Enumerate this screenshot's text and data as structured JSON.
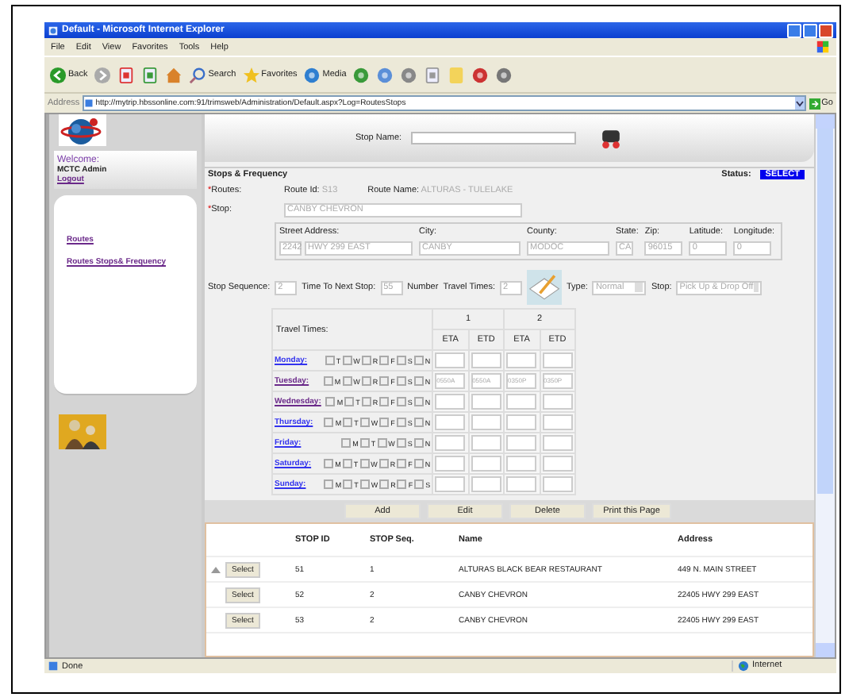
{
  "window": {
    "title": "Default - Microsoft Internet Explorer"
  },
  "menu": [
    "File",
    "Edit",
    "View",
    "Favorites",
    "Tools",
    "Help"
  ],
  "toolbar": [
    {
      "kind": "back",
      "label": "Back"
    },
    {
      "kind": "forward"
    },
    {
      "kind": "stop"
    },
    {
      "kind": "refresh"
    },
    {
      "kind": "home"
    },
    {
      "kind": "search",
      "label": "Search"
    },
    {
      "kind": "favorites",
      "label": "Favorites"
    },
    {
      "kind": "media",
      "label": "Media"
    },
    {
      "kind": "history"
    },
    {
      "kind": "mail"
    },
    {
      "kind": "print"
    },
    {
      "kind": "edit"
    },
    {
      "kind": "notes"
    },
    {
      "kind": "messenger"
    },
    {
      "kind": "chat"
    }
  ],
  "address": {
    "label": "Address",
    "url": "http://mytrip.hbssonline.com:91/trimsweb/Administration/Default.aspx?Log=RoutesStops",
    "go": "Go"
  },
  "sidebar": {
    "welcome": "Welcome:",
    "user": "MCTC Admin",
    "logout": "Logout",
    "links": [
      "Routes",
      "Routes Stops& Frequency"
    ]
  },
  "header": {
    "stop_name_label": "Stop Name:"
  },
  "form": {
    "title": "Stops & Frequency",
    "status_label": "Status:",
    "status": "SELECT",
    "required_mark": "*",
    "routes_label": "Routes:",
    "route_id_label": "Route Id:",
    "route_id": "S13",
    "route_name_label": "Route Name:",
    "route_name": "ALTURAS - TULELAKE",
    "stop_label": "Stop:",
    "stop": "CANBY CHEVRON",
    "address_fields": [
      {
        "label": "Street Address:",
        "values": [
          "2242",
          "HWY 299 EAST"
        ]
      },
      {
        "label": "City:",
        "values": [
          "CANBY"
        ]
      },
      {
        "label": "County:",
        "values": [
          "MODOC"
        ]
      },
      {
        "label": "State:",
        "values": [
          "CA"
        ]
      },
      {
        "label": "Zip:",
        "values": [
          "96015"
        ]
      },
      {
        "label": "Latitude:",
        "values": [
          "0"
        ]
      },
      {
        "label": "Longitude:",
        "values": [
          "0"
        ]
      }
    ],
    "stop_sequence_label": "Stop Sequence:",
    "stop_sequence": "2",
    "time_next_label": "Time To Next Stop:",
    "time_next": "55",
    "number_label": "Number",
    "travel_times_count_label": "Travel Times:",
    "travel_times_count": "2",
    "type_label": "Type:",
    "type": "Normal",
    "stop_type_label": "Stop:",
    "stop_type": "Pick Up & Drop Off"
  },
  "travel": {
    "label": "Travel Times:",
    "columns": [
      {
        "label": "1",
        "sub": [
          "ETA",
          "ETD"
        ]
      },
      {
        "label": "2",
        "sub": [
          "ETA",
          "ETD"
        ]
      }
    ],
    "days": [
      {
        "name": "Monday:",
        "visited": false,
        "letters": [
          {
            "letter": "T",
            "checked": false
          },
          {
            "letter": "W",
            "checked": false
          },
          {
            "letter": "R",
            "checked": false
          },
          {
            "letter": "F",
            "checked": false
          },
          {
            "letter": "S",
            "checked": false
          },
          {
            "letter": "N",
            "checked": false
          }
        ]
      },
      {
        "name": "Tuesday:",
        "visited": true,
        "letters": [
          {
            "letter": "M",
            "checked": false
          },
          {
            "letter": "W",
            "checked": false
          },
          {
            "letter": "R",
            "checked": false
          },
          {
            "letter": "F",
            "checked": false
          },
          {
            "letter": "S",
            "checked": false
          },
          {
            "letter": "N",
            "checked": false
          }
        ],
        "times": [
          "0550A",
          "0550A",
          "0350P",
          "0350P"
        ]
      },
      {
        "name": "Wednesday:",
        "visited": true,
        "letters": [
          {
            "letter": "M",
            "checked": false
          },
          {
            "letter": "T",
            "checked": false
          },
          {
            "letter": "R",
            "checked": false
          },
          {
            "letter": "F",
            "checked": false
          },
          {
            "letter": "S",
            "checked": false
          },
          {
            "letter": "N",
            "checked": false
          }
        ]
      },
      {
        "name": "Thursday:",
        "visited": false,
        "letters": [
          {
            "letter": "M",
            "checked": false
          },
          {
            "letter": "T",
            "checked": false
          },
          {
            "letter": "W",
            "checked": false
          },
          {
            "letter": "F",
            "checked": false
          },
          {
            "letter": "S",
            "checked": false
          },
          {
            "letter": "N",
            "checked": false
          }
        ]
      },
      {
        "name": "Friday:",
        "visited": false,
        "letters": [
          {
            "letter": "M",
            "checked": false
          },
          {
            "letter": "T",
            "checked": false
          },
          {
            "letter": "W",
            "checked": false
          },
          {
            "letter": "S",
            "checked": false
          },
          {
            "letter": "N",
            "checked": false
          }
        ]
      },
      {
        "name": "Saturday:",
        "visited": false,
        "letters": [
          {
            "letter": "M",
            "checked": false
          },
          {
            "letter": "T",
            "checked": false
          },
          {
            "letter": "W",
            "checked": false
          },
          {
            "letter": "R",
            "checked": false
          },
          {
            "letter": "F",
            "checked": false
          },
          {
            "letter": "N",
            "checked": false
          }
        ]
      },
      {
        "name": "Sunday:",
        "visited": false,
        "letters": [
          {
            "letter": "M",
            "checked": false
          },
          {
            "letter": "T",
            "checked": false
          },
          {
            "letter": "W",
            "checked": false
          },
          {
            "letter": "R",
            "checked": false
          },
          {
            "letter": "F",
            "checked": false
          },
          {
            "letter": "S",
            "checked": false
          }
        ]
      }
    ]
  },
  "buttons": [
    "Add",
    "Edit",
    "Delete",
    "Print this Page"
  ],
  "grid": {
    "columns": [
      "STOP ID",
      "STOP Seq.",
      "Name",
      "Address"
    ],
    "rows": [
      {
        "select": "Select",
        "id": "51",
        "seq": "1",
        "name": "ALTURAS BLACK BEAR RESTAURANT",
        "address": "449 N. MAIN STREET",
        "sorted": true
      },
      {
        "select": "Select",
        "id": "52",
        "seq": "2",
        "name": "CANBY CHEVRON",
        "address": "22405 HWY 299 EAST",
        "sorted": false
      },
      {
        "select": "Select",
        "id": "53",
        "seq": "2",
        "name": "CANBY CHEVRON",
        "address": "22405 HWY 299 EAST",
        "sorted": false
      }
    ]
  },
  "status_bar": {
    "text": "Done",
    "zone": "Internet"
  }
}
